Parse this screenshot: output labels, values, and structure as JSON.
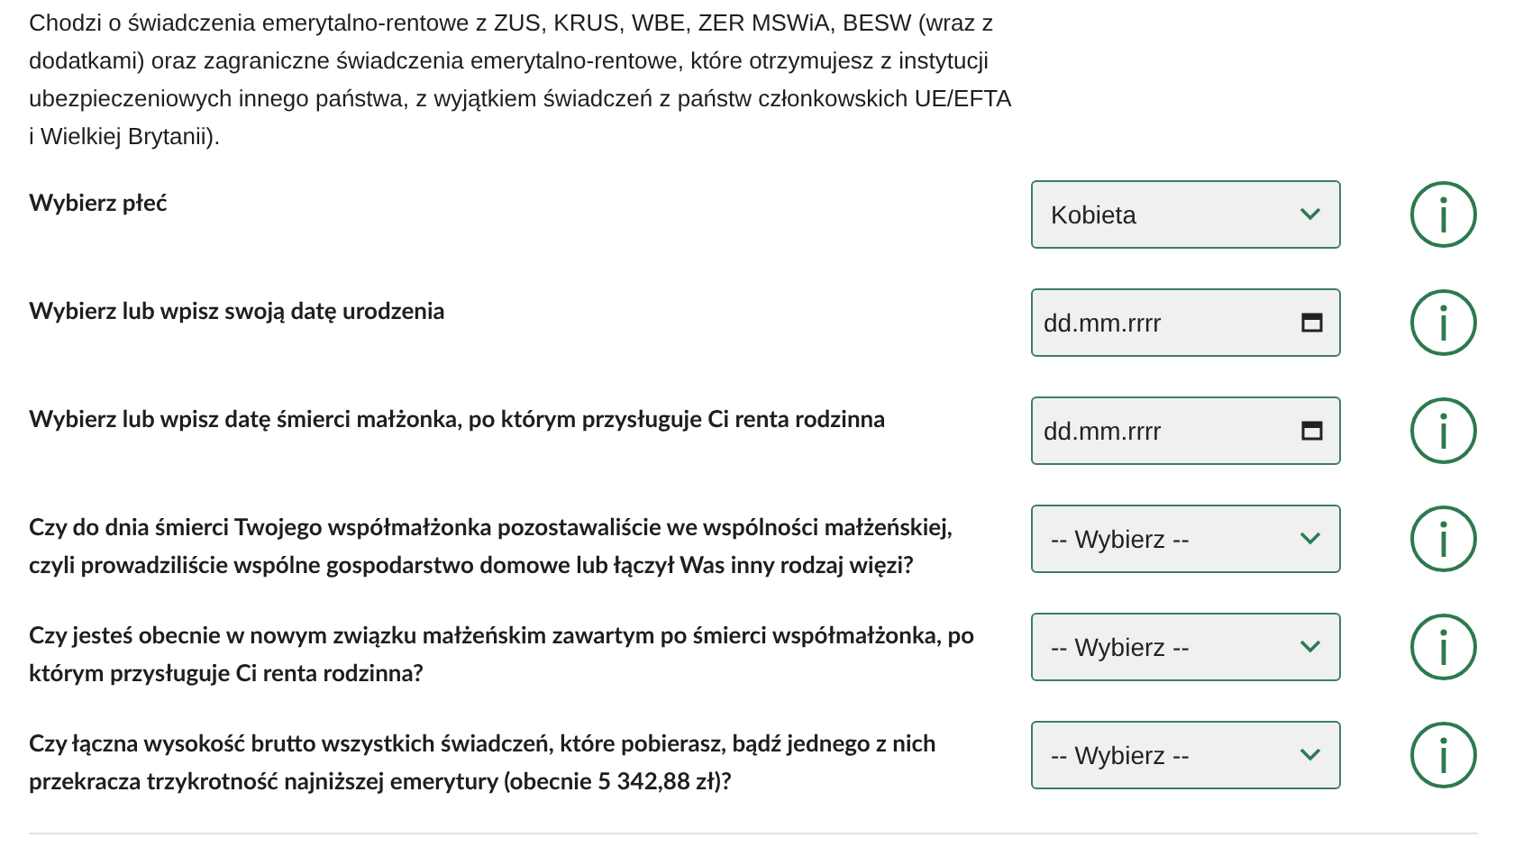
{
  "intro": "Chodzi o świadczenia emerytalno-rentowe z ZUS, KRUS, WBE, ZER MSWiA, BESW (wraz z dodatkami) oraz zagraniczne świadczenia emerytalno-rentowe, które otrzymujesz z instytucji ubezpieczeniowych innego państwa, z wyjątkiem świadczeń z państw członkowskich UE/EFTA i Wielkiej Brytanii).",
  "questions": [
    {
      "label": "Wybierz płeć",
      "kind": "select",
      "value": "Kobieta"
    },
    {
      "label": "Wybierz lub wpisz swoją datę urodzenia",
      "kind": "date",
      "placeholder": "dd.mm.rrrr"
    },
    {
      "label": "Wybierz lub wpisz datę śmierci małżonka, po którym przysługuje Ci renta rodzinna",
      "kind": "date",
      "placeholder": "dd.mm.rrrr"
    },
    {
      "label": "Czy do dnia śmierci Twojego współmałżonka pozostawaliście we wspólności małżeńskiej, czyli prowadziliście wspólne gospodarstwo domowe lub łączył Was inny rodzaj więzi?",
      "kind": "select",
      "value": "-- Wybierz --"
    },
    {
      "label": "Czy jesteś obecnie w nowym związku małżeńskim zawartym po śmierci współmałżonka, po którym przysługuje Ci renta rodzinna?",
      "kind": "select",
      "value": "-- Wybierz --"
    },
    {
      "label": "Czy łączna wysokość brutto wszystkich świadczeń, które pobierasz, bądź jednego z nich przekracza trzykrotność najniższej emerytury (obecnie 5 342,88 zł)?",
      "kind": "select",
      "value": "-- Wybierz --"
    }
  ]
}
